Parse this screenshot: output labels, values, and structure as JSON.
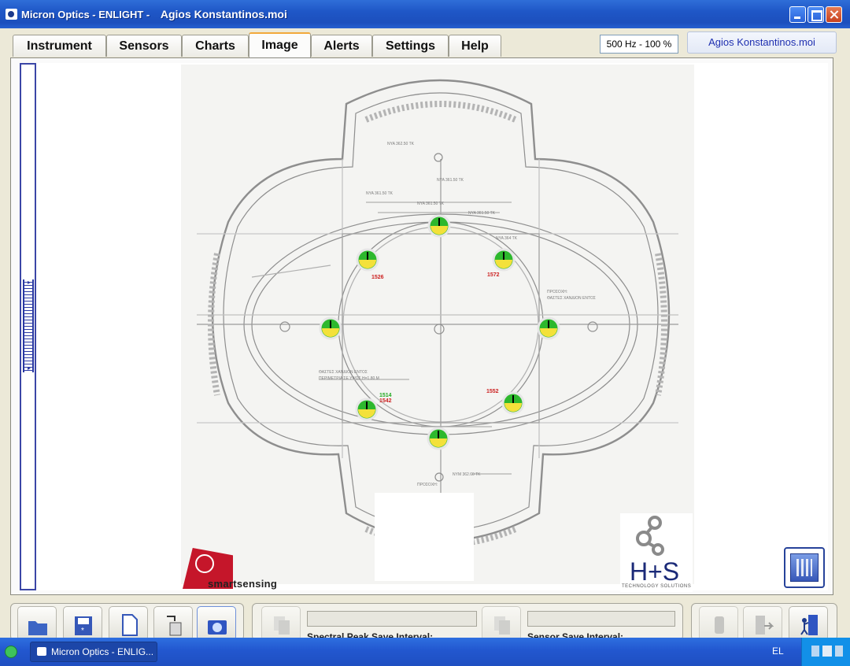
{
  "window": {
    "app_title": "Micron Optics - ENLIGHT -",
    "document_title": "Agios Konstantinos.moi"
  },
  "tabs": [
    {
      "label": "Instrument",
      "active": false
    },
    {
      "label": "Sensors",
      "active": false
    },
    {
      "label": "Charts",
      "active": false
    },
    {
      "label": "Image",
      "active": true
    },
    {
      "label": "Alerts",
      "active": false
    },
    {
      "label": "Settings",
      "active": false
    },
    {
      "label": "Help",
      "active": false
    }
  ],
  "status": {
    "sample_rate": "500 Hz - 100 %",
    "file_name": "Agios Konstantinos.moi"
  },
  "plan": {
    "sensor_labels": [
      "1526",
      "1572",
      "1514",
      "1542",
      "1552"
    ],
    "sensor_status_color": "#2db82d",
    "label_color": "#cc2222",
    "label_green_color": "#22aa22"
  },
  "logos": {
    "left_text": "smartsensing",
    "right_name": "H+S",
    "right_sub": "TECHNOLOGY SOLUTIONS"
  },
  "toolbar": {
    "spectral_label": "Spectral Peak Save Interval:",
    "sensor_label": "Sensor Save Interval:"
  },
  "taskbar": {
    "item": "Micron Optics - ENLIG...",
    "language": "EL"
  }
}
